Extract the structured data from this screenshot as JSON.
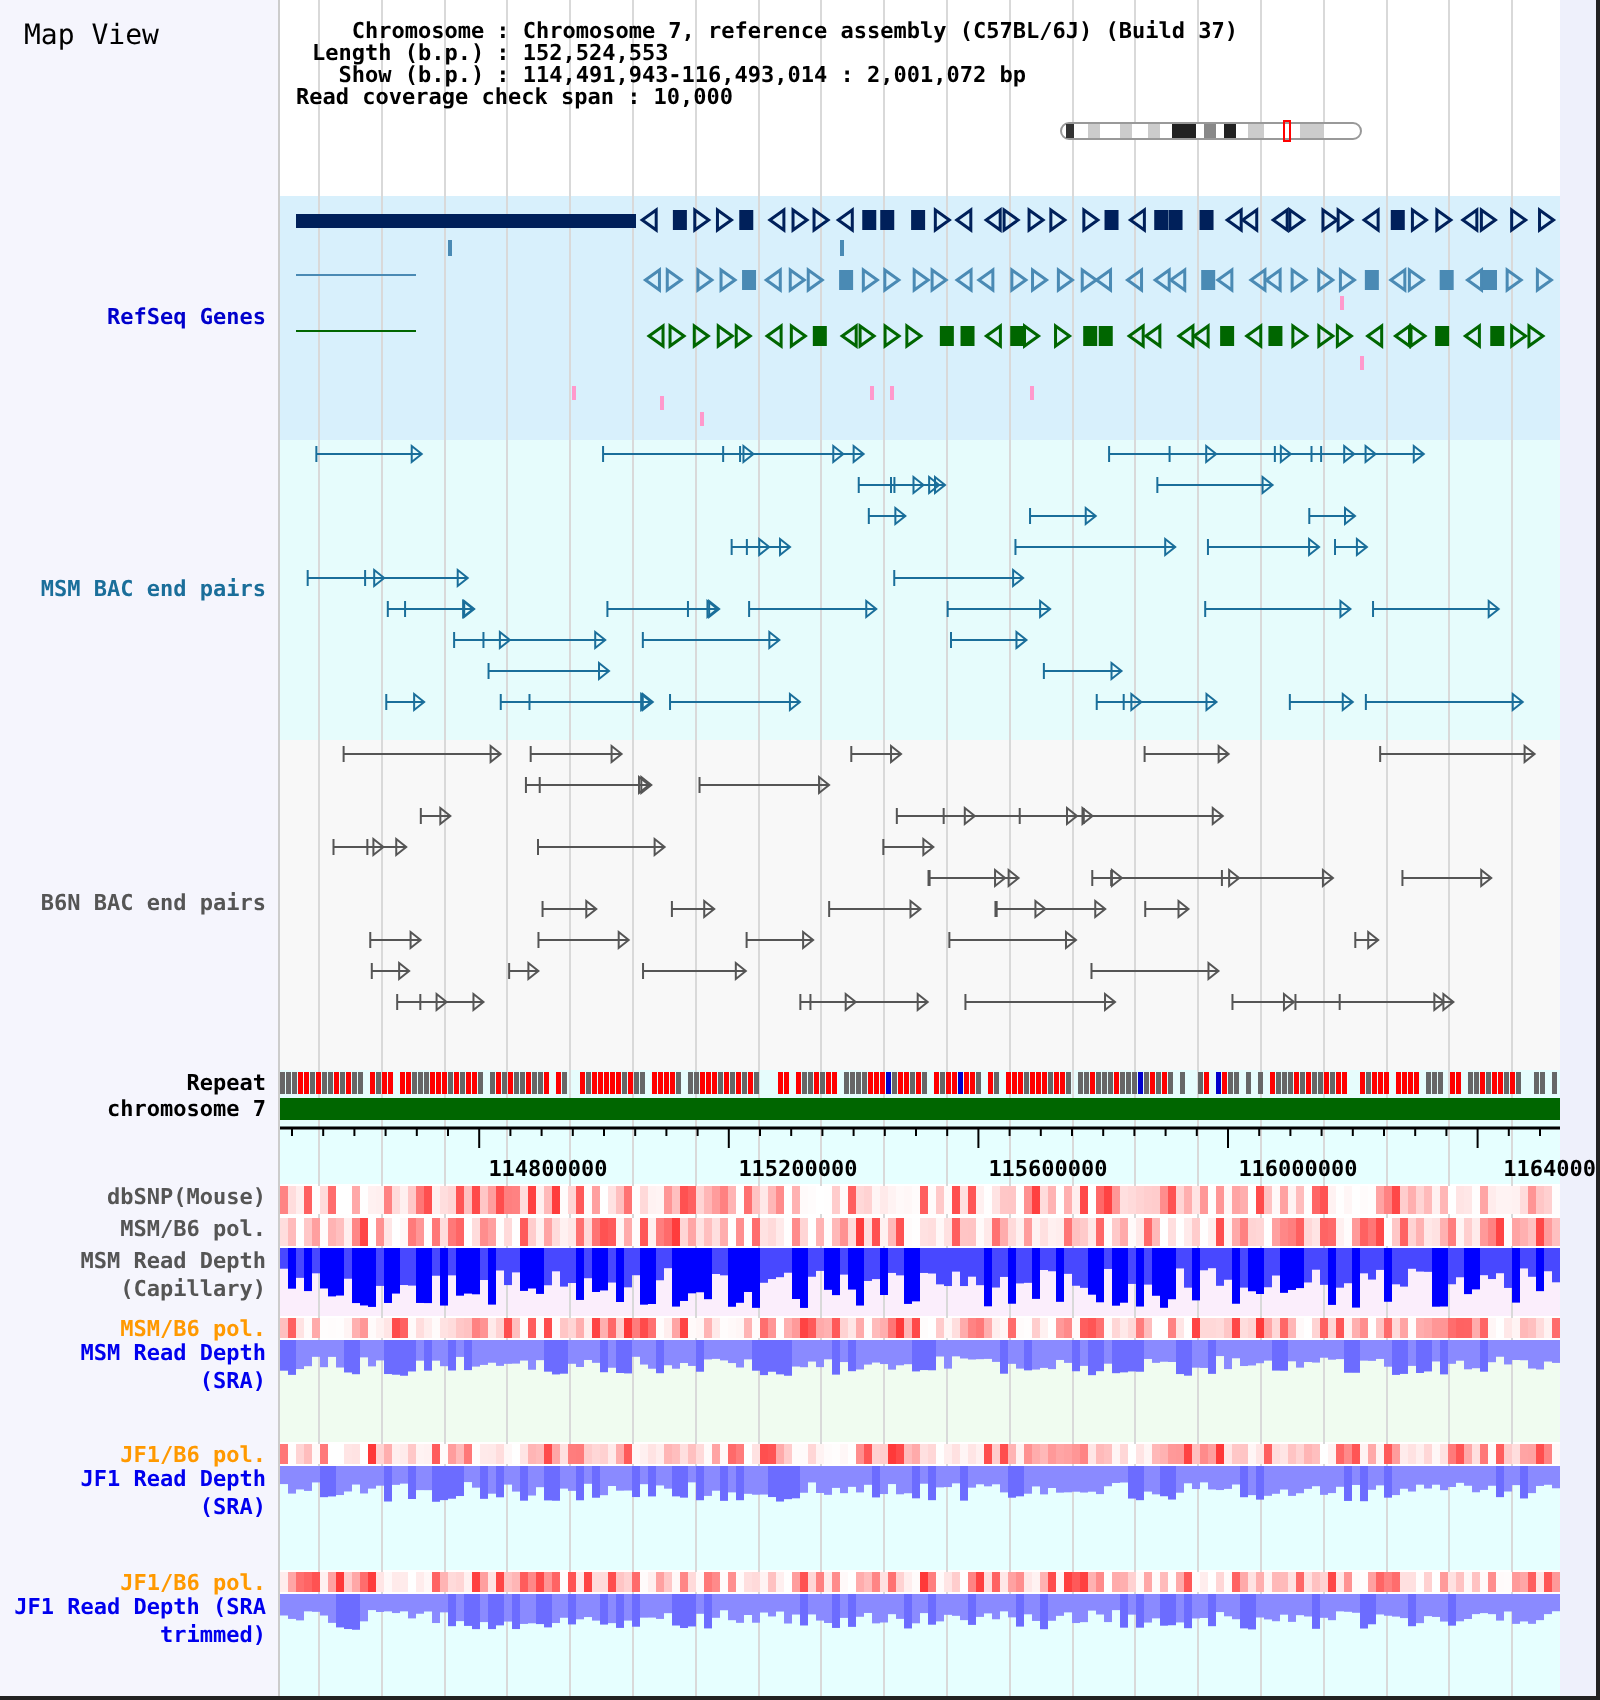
{
  "title": "Map View",
  "info": [
    {
      "label": "Chromosome",
      "value": ": Chromosome 7, reference assembly (C57BL/6J) (Build 37)"
    },
    {
      "label": "Length (b.p.)",
      "value": ": 152,524,553"
    },
    {
      "label": "Show (b.p.)",
      "value": ": 114,491,943-116,493,014 : 2,001,072 bp"
    }
  ],
  "note": "Read coverage check span : 10,000",
  "tracks": [
    {
      "kind": "genes",
      "label": "RefSeq Genes",
      "color": "#0000cc"
    },
    {
      "kind": "pairs",
      "label": "MSM BAC end pairs",
      "color": "#1a6e9a"
    },
    {
      "kind": "pairs",
      "label": "B6N BAC end pairs",
      "color": "#555555"
    },
    {
      "kind": "repeat",
      "label": "Repeat",
      "color": "#000000"
    },
    {
      "kind": "chromosome",
      "label": "chromosome 7",
      "color": "#000000"
    },
    {
      "kind": "axis",
      "labels": [
        "114800000",
        "115200000",
        "115600000",
        "116000000",
        "1164000"
      ]
    },
    {
      "kind": "heat",
      "label": "dbSNP(Mouse)",
      "color": "#555555"
    },
    {
      "kind": "heat",
      "label": "MSM/B6 pol.",
      "color": "#555555"
    },
    {
      "kind": "depth",
      "label": "MSM Read Depth (Capillary)",
      "color": "#555555"
    },
    {
      "kind": "heat",
      "label": "MSM/B6 pol.",
      "color": "#ff9900"
    },
    {
      "kind": "depth",
      "label": "MSM Read Depth (SRA)",
      "color": "#0000ee"
    },
    {
      "kind": "heat",
      "label": "JF1/B6 pol.",
      "color": "#ff9900"
    },
    {
      "kind": "depth",
      "label": "JF1 Read Depth (SRA)",
      "color": "#0000ee"
    },
    {
      "kind": "heat",
      "label": "JF1/B6 pol.",
      "color": "#ff9900"
    },
    {
      "kind": "depth",
      "label": "JF1 Read Depth (SRA trimmed)",
      "color": "#0000ee"
    }
  ]
}
